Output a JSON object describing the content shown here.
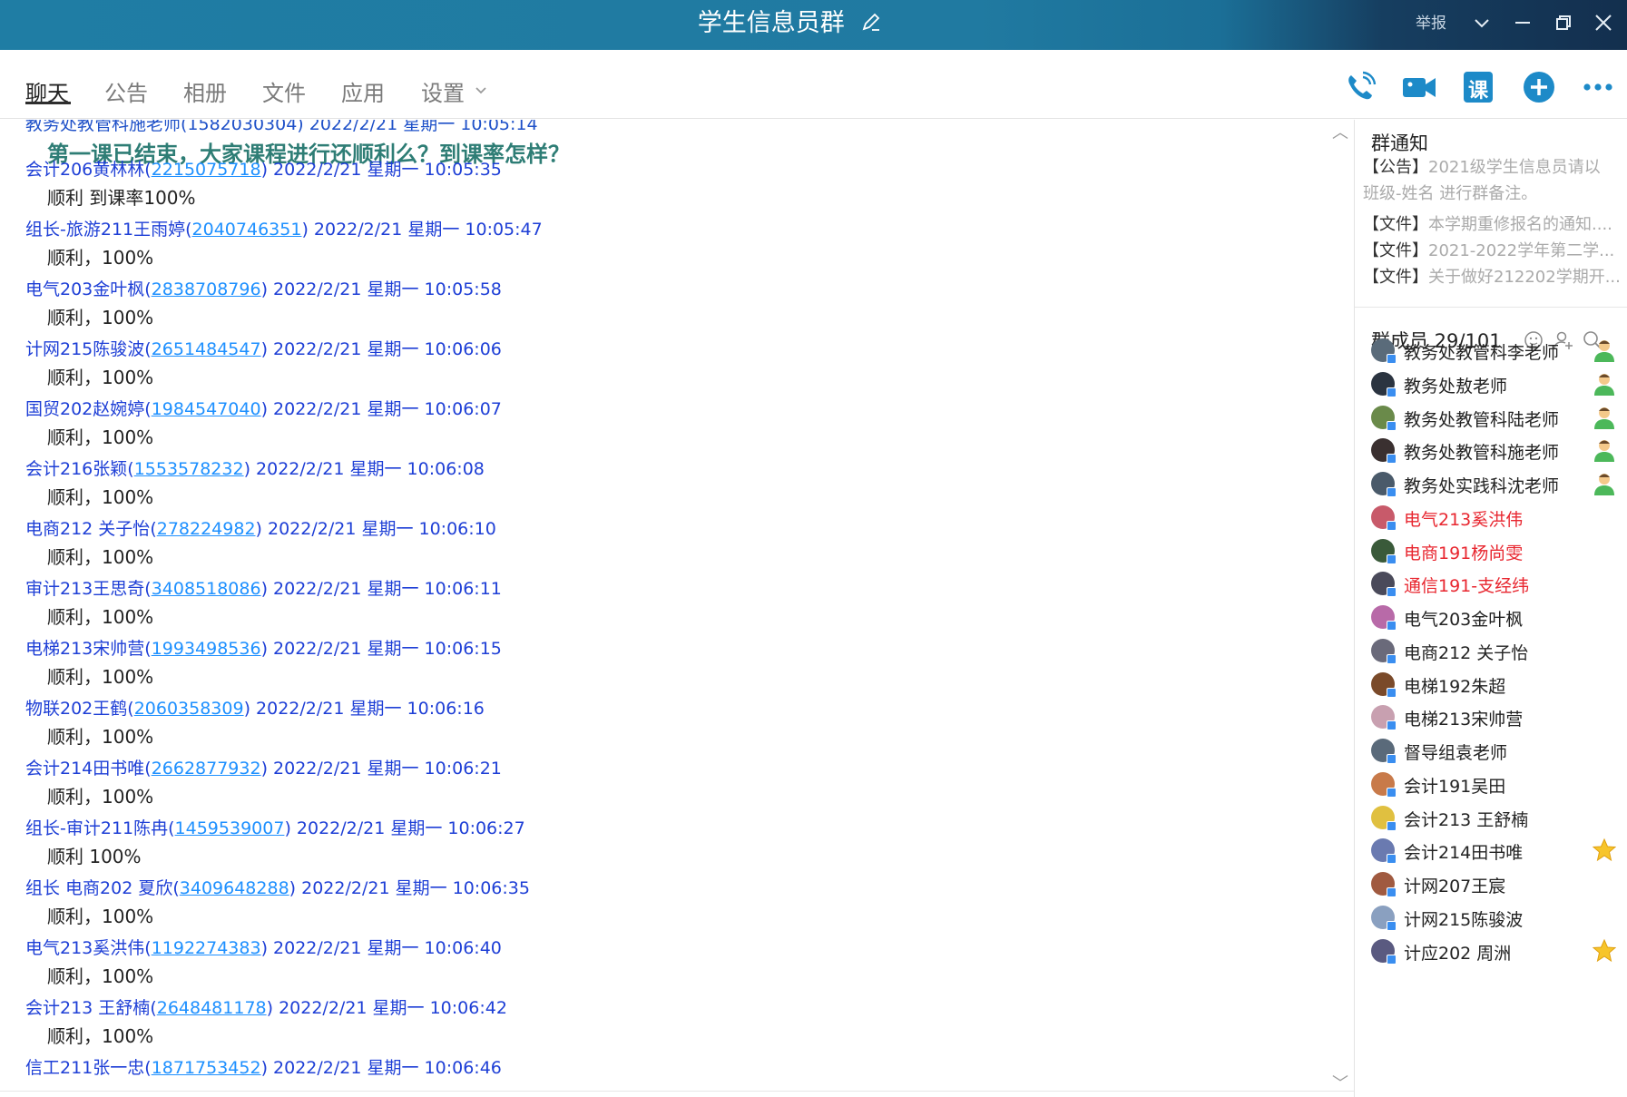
{
  "window": {
    "title": "学生信息员群",
    "report_label": "举报"
  },
  "tabs": [
    "聊天",
    "公告",
    "相册",
    "文件",
    "应用",
    "设置"
  ],
  "toolbar": {
    "lesson_label": "课"
  },
  "chat": {
    "partial_top": "教务处教管科施老师(1582030304) 2022/2/21 星期一 10:05:14",
    "headline": "第一课已结束，大家课程进行还顺利么？到课率怎样？",
    "messages": [
      {
        "sender": "会计206黄林林",
        "qq": "2215075718",
        "time": "2022/2/21 星期一 10:05:35",
        "text": "顺利 到课率100%"
      },
      {
        "sender": "组长-旅游211王雨婷",
        "qq": "2040746351",
        "time": "2022/2/21 星期一 10:05:47",
        "text": "顺利，100%"
      },
      {
        "sender": "电气203金叶枫",
        "qq": "2838708796",
        "time": "2022/2/21 星期一 10:05:58",
        "text": "顺利，100%"
      },
      {
        "sender": "计网215陈骏波",
        "qq": "2651484547",
        "time": "2022/2/21 星期一 10:06:06",
        "text": "顺利，100%"
      },
      {
        "sender": "国贸202赵婉婷",
        "qq": "1984547040",
        "time": "2022/2/21 星期一 10:06:07",
        "text": "顺利，100%"
      },
      {
        "sender": "会计216张颖",
        "qq": "1553578232",
        "time": "2022/2/21 星期一 10:06:08",
        "text": "顺利，100%"
      },
      {
        "sender": "电商212 关子怡",
        "qq": "278224982",
        "time": "2022/2/21 星期一 10:06:10",
        "text": "顺利，100%"
      },
      {
        "sender": "审计213王思奇",
        "qq": "3408518086",
        "time": "2022/2/21 星期一 10:06:11",
        "text": "顺利，100%"
      },
      {
        "sender": "电梯213宋帅营",
        "qq": "1993498536",
        "time": "2022/2/21 星期一 10:06:15",
        "text": "顺利，100%"
      },
      {
        "sender": "物联202王鹤",
        "qq": "2060358309",
        "time": "2022/2/21 星期一 10:06:16",
        "text": "顺利，100%"
      },
      {
        "sender": "会计214田书唯",
        "qq": "2662877932",
        "time": "2022/2/21 星期一 10:06:21",
        "text": "顺利，100%"
      },
      {
        "sender": "组长-审计211陈冉",
        "qq": "1459539007",
        "time": "2022/2/21 星期一 10:06:27",
        "text": "顺利 100%"
      },
      {
        "sender": "组长  电商202 夏欣",
        "qq": "3409648288",
        "time": "2022/2/21 星期一 10:06:35",
        "text": "顺利，100%"
      },
      {
        "sender": "电气213奚洪伟",
        "qq": "1192274383",
        "time": "2022/2/21 星期一 10:06:40",
        "text": "顺利，100%"
      },
      {
        "sender": "会计213 王舒楠",
        "qq": "2648481178",
        "time": "2022/2/21 星期一 10:06:42",
        "text": "顺利，100%"
      },
      {
        "sender": "信工211张一忠",
        "qq": "1871753452",
        "time": "2022/2/21 星期一 10:06:46",
        "text": ""
      }
    ]
  },
  "sidebar": {
    "notice_title": "群通知",
    "notices": [
      {
        "tag": "【公告】",
        "text": "2021级学生信息员请以"
      },
      {
        "tag": "",
        "text": "班级-姓名 进行群备注。"
      },
      {
        "tag": "【文件】",
        "text": "本学期重修报名的通知...."
      },
      {
        "tag": "【文件】",
        "text": "2021-2022学年第二学..."
      },
      {
        "tag": "【文件】",
        "text": "关于做好212202学期开..."
      }
    ],
    "members_title": "群成员 29/101",
    "members": [
      {
        "name": "教务处教管科李老师",
        "color": "#222222",
        "role": "admin"
      },
      {
        "name": "教务处敖老师",
        "color": "#222222",
        "role": "admin"
      },
      {
        "name": "教务处教管科陆老师",
        "color": "#222222",
        "role": "admin"
      },
      {
        "name": "教务处教管科施老师",
        "color": "#222222",
        "role": "admin"
      },
      {
        "name": "教务处实践科沈老师",
        "color": "#222222",
        "role": "admin"
      },
      {
        "name": "电气213奚洪伟",
        "color": "#e8262f",
        "role": ""
      },
      {
        "name": "电商191杨尚雯",
        "color": "#e8262f",
        "role": ""
      },
      {
        "name": "通信191-支经纬",
        "color": "#e8262f",
        "role": ""
      },
      {
        "name": "电气203金叶枫",
        "color": "#222222",
        "role": ""
      },
      {
        "name": "电商212 关子怡",
        "color": "#222222",
        "role": ""
      },
      {
        "name": "电梯192朱超",
        "color": "#222222",
        "role": ""
      },
      {
        "name": "电梯213宋帅营",
        "color": "#222222",
        "role": ""
      },
      {
        "name": "督导组袁老师",
        "color": "#222222",
        "role": ""
      },
      {
        "name": "会计191吴田",
        "color": "#222222",
        "role": ""
      },
      {
        "name": "会计213 王舒楠",
        "color": "#222222",
        "role": ""
      },
      {
        "name": "会计214田书唯",
        "color": "#222222",
        "role": "star"
      },
      {
        "name": "计网207王宸",
        "color": "#222222",
        "role": ""
      },
      {
        "name": "计网215陈骏波",
        "color": "#222222",
        "role": ""
      },
      {
        "name": "计应202 周洲",
        "color": "#222222",
        "role": "star"
      }
    ]
  },
  "colors": {
    "titlebar": "#1f7da4",
    "sender_link": "#1e3fd6",
    "qq_link": "#1e90ff",
    "headline": "#2e7d75",
    "toolbar_icon": "#1d8ac8",
    "red_member": "#e8262f"
  }
}
